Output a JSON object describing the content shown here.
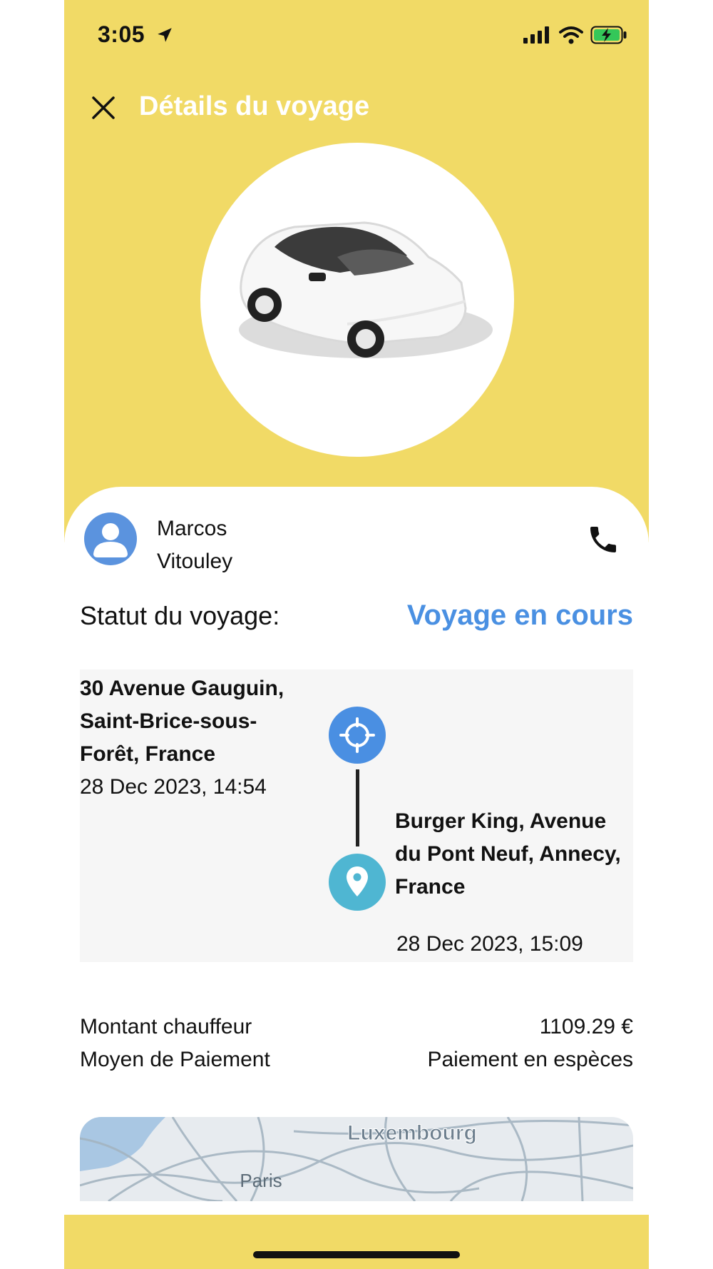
{
  "status_bar": {
    "time": "3:05"
  },
  "header": {
    "title": "Détails du voyage"
  },
  "driver": {
    "first_name": "Marcos",
    "last_name": "Vitouley"
  },
  "trip": {
    "status_label": "Statut du voyage:",
    "status_value": "Voyage en cours",
    "pickup": {
      "address": "30 Avenue Gauguin, Saint-Brice-sous-Forêt, France",
      "time": "28 Dec 2023, 14:54"
    },
    "dropoff": {
      "address": "Burger King, Avenue du Pont Neuf, Annecy, France",
      "time": "28 Dec 2023, 15:09"
    }
  },
  "fare": {
    "driver_amount_label": "Montant chauffeur",
    "driver_amount_value": "1109.29 €",
    "payment_method_label": "Moyen de Paiement",
    "payment_method_value": "Paiement en espèces"
  },
  "map": {
    "labels": [
      "Luxembourg",
      "Paris"
    ]
  },
  "colors": {
    "accent_yellow": "#f1da66",
    "status_blue": "#4a90e2",
    "pin_origin": "#4a8fe2",
    "pin_destination": "#4fb6d2",
    "avatar_blue": "#5b93de"
  },
  "icons": [
    "location-arrow-icon",
    "signal-icon",
    "wifi-icon",
    "battery-charging-icon",
    "close-icon",
    "car-image",
    "user-avatar-icon",
    "phone-icon",
    "crosshair-pin-icon",
    "map-pin-icon"
  ]
}
